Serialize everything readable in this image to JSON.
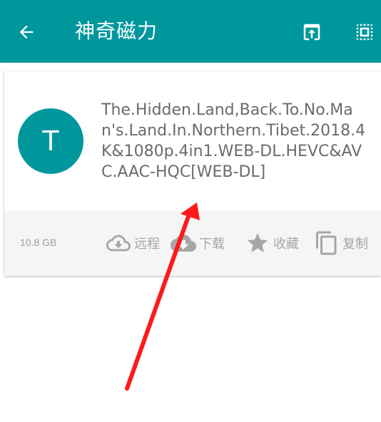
{
  "toolbar": {
    "title": "神奇磁力",
    "background": "#00979c",
    "icons": {
      "back": "arrow-left-icon",
      "upload": "upload-box-icon",
      "select": "select-all-icon"
    }
  },
  "item": {
    "avatar_letter": "T",
    "avatar_color": "#00979c",
    "name": "The.Hidden.Land,Back.To.No.Man's.Land.In.Northern.Tibet.2018.4K&1080p.4in1.WEB-DL.HEVC&AVC.AAC-HQC[WEB-DL]",
    "size": "10.8 GB",
    "actions": {
      "remote": "远程",
      "download": "下载",
      "favorite": "收藏",
      "copy": "复制"
    }
  },
  "annotation": {
    "color": "#ff1a1a",
    "type": "red-arrow"
  }
}
